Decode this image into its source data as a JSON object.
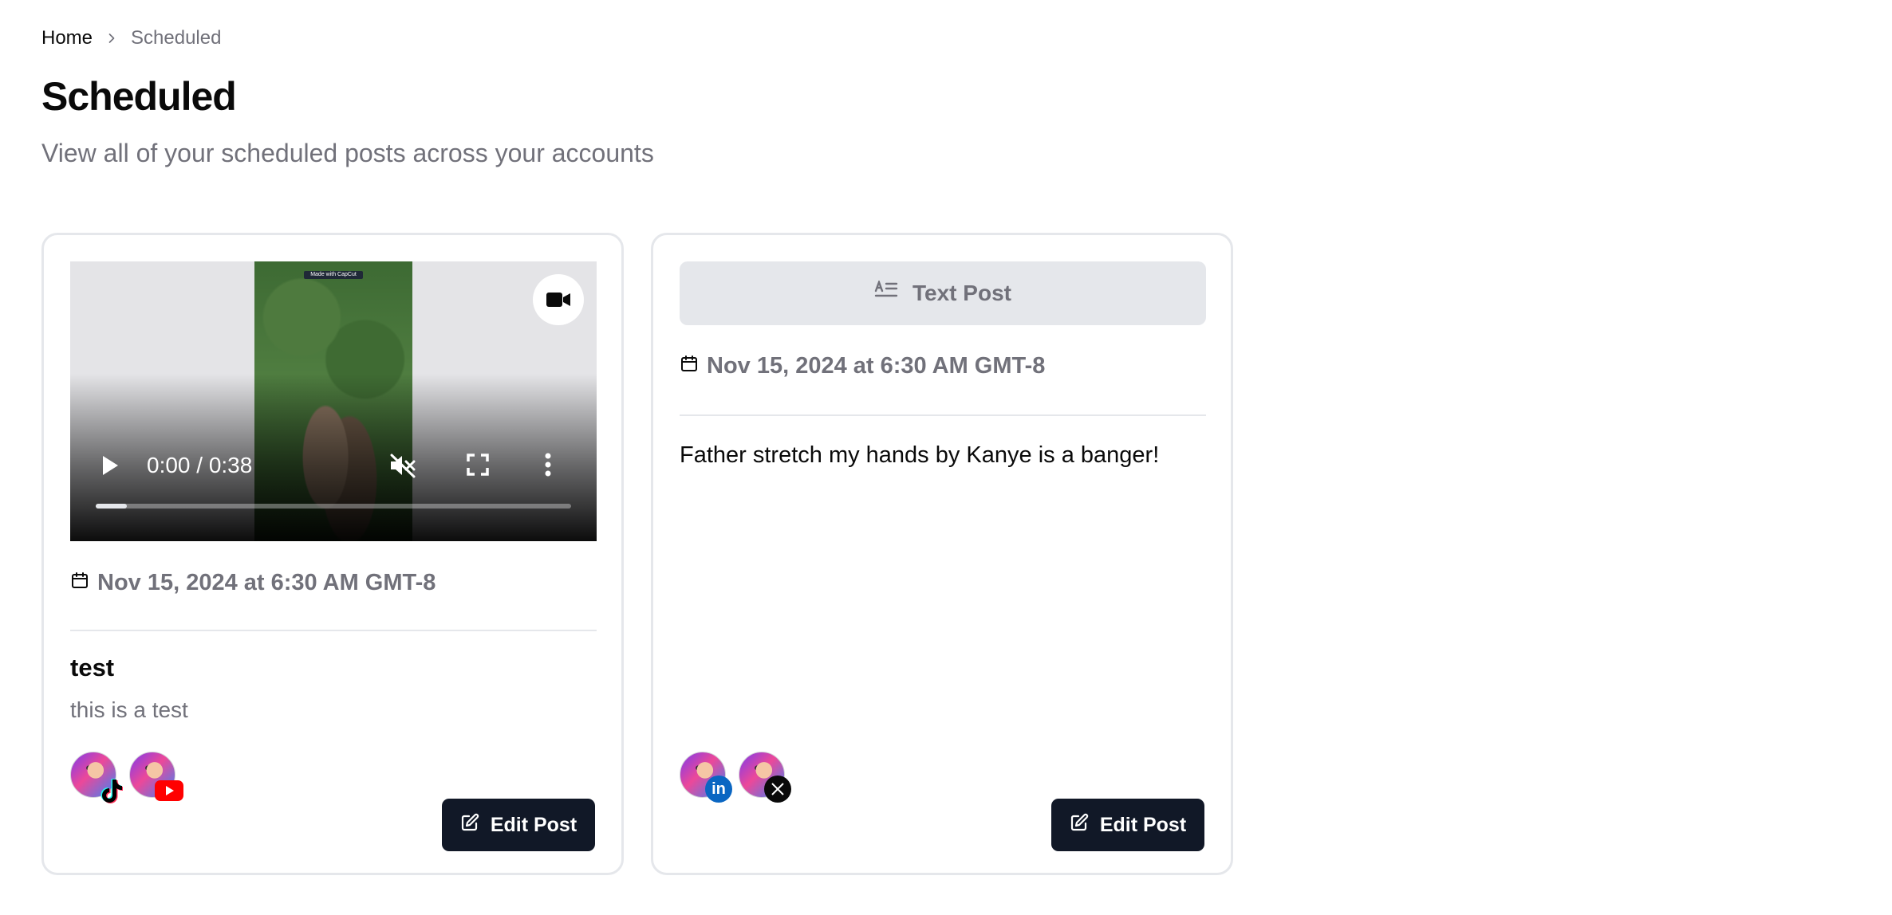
{
  "breadcrumb": {
    "home": "Home",
    "current": "Scheduled"
  },
  "header": {
    "title": "Scheduled",
    "subtitle": "View all of your scheduled posts across your accounts"
  },
  "posts": [
    {
      "type": "video",
      "video": {
        "time": "0:00 / 0:38",
        "progress_fraction": 0.066,
        "watermark": "Made with CapCut",
        "muted": true
      },
      "date": "Nov 15, 2024 at 6:30 AM GMT-8",
      "title": "test",
      "body": "this is a test",
      "accounts": [
        "tiktok",
        "youtube"
      ],
      "edit_label": "Edit Post"
    },
    {
      "type": "text",
      "banner_label": "Text Post",
      "date": "Nov 15, 2024 at 6:30 AM GMT-8",
      "body": "Father stretch my hands by Kanye is a banger!",
      "accounts": [
        "linkedin",
        "x"
      ],
      "edit_label": "Edit Post"
    }
  ],
  "colors": {
    "primary_button": "#111827",
    "muted_text": "#71717a",
    "border": "#e5e7eb",
    "youtube": "#ff0000",
    "linkedin": "#0a66c2"
  }
}
